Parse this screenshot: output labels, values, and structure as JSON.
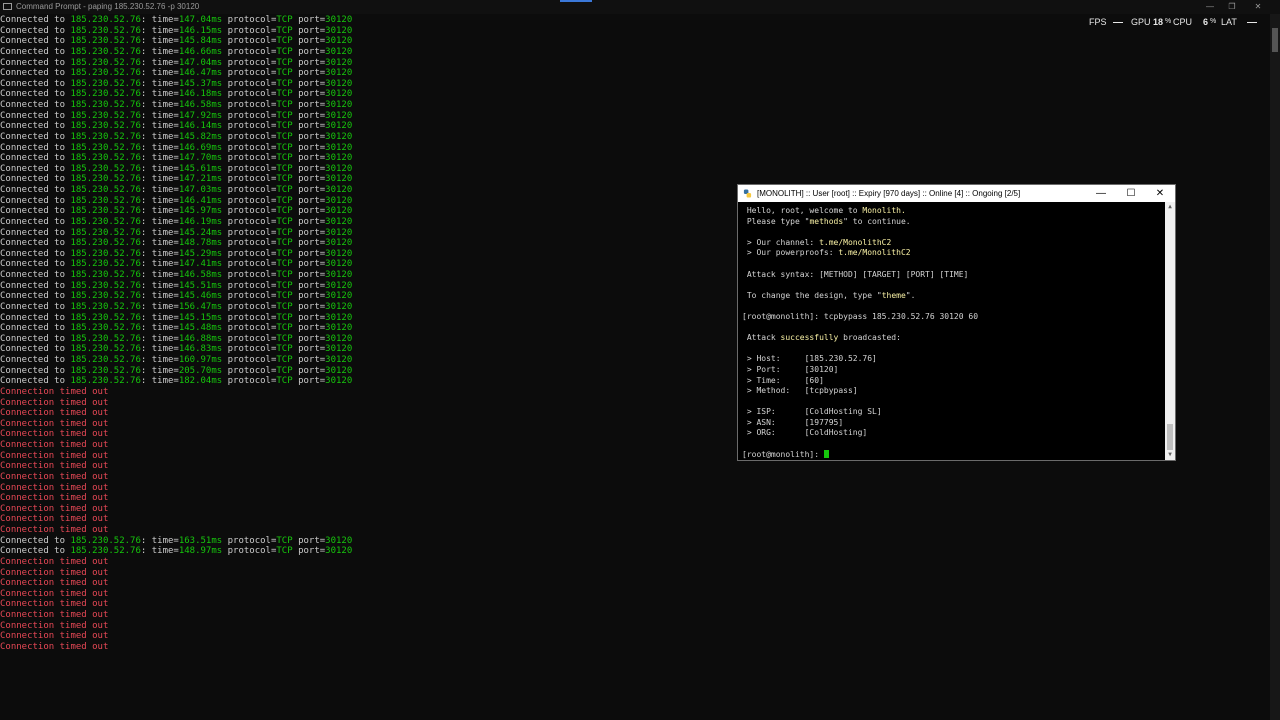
{
  "window": {
    "title": "Command Prompt - paping  185.230.52.76 -p 30120",
    "minimize": "—",
    "restore": "❐",
    "close": "✕"
  },
  "overlay": {
    "fps_label": "FPS",
    "gpu_label": "GPU",
    "gpu_value": "18",
    "gpu_unit": "%",
    "cpu_label": "CPU",
    "cpu_value": "6",
    "cpu_unit": "%",
    "lat_label": "LAT"
  },
  "console": {
    "connected_prefix": "Connected to ",
    "ip": "185.230.52.76",
    "time_label": ": time=",
    "protocol_label": " protocol=",
    "protocol": "TCP",
    "port_label": " port=",
    "port": "30120",
    "timeout_text": "Connection timed out",
    "lines": [
      {
        "t": "ok",
        "ms": "147.04ms"
      },
      {
        "t": "ok",
        "ms": "146.15ms"
      },
      {
        "t": "ok",
        "ms": "145.84ms"
      },
      {
        "t": "ok",
        "ms": "146.66ms"
      },
      {
        "t": "ok",
        "ms": "147.04ms"
      },
      {
        "t": "ok",
        "ms": "146.47ms"
      },
      {
        "t": "ok",
        "ms": "145.37ms"
      },
      {
        "t": "ok",
        "ms": "146.18ms"
      },
      {
        "t": "ok",
        "ms": "146.58ms"
      },
      {
        "t": "ok",
        "ms": "147.92ms"
      },
      {
        "t": "ok",
        "ms": "146.14ms"
      },
      {
        "t": "ok",
        "ms": "145.82ms"
      },
      {
        "t": "ok",
        "ms": "146.69ms"
      },
      {
        "t": "ok",
        "ms": "147.70ms"
      },
      {
        "t": "ok",
        "ms": "145.61ms"
      },
      {
        "t": "ok",
        "ms": "147.21ms"
      },
      {
        "t": "ok",
        "ms": "147.03ms"
      },
      {
        "t": "ok",
        "ms": "146.41ms"
      },
      {
        "t": "ok",
        "ms": "145.97ms"
      },
      {
        "t": "ok",
        "ms": "146.19ms"
      },
      {
        "t": "ok",
        "ms": "145.24ms"
      },
      {
        "t": "ok",
        "ms": "148.78ms"
      },
      {
        "t": "ok",
        "ms": "145.29ms"
      },
      {
        "t": "ok",
        "ms": "147.41ms"
      },
      {
        "t": "ok",
        "ms": "146.58ms"
      },
      {
        "t": "ok",
        "ms": "145.51ms"
      },
      {
        "t": "ok",
        "ms": "145.46ms"
      },
      {
        "t": "ok",
        "ms": "156.47ms"
      },
      {
        "t": "ok",
        "ms": "145.15ms"
      },
      {
        "t": "ok",
        "ms": "145.48ms"
      },
      {
        "t": "ok",
        "ms": "146.88ms"
      },
      {
        "t": "ok",
        "ms": "146.83ms"
      },
      {
        "t": "ok",
        "ms": "160.97ms"
      },
      {
        "t": "ok",
        "ms": "205.70ms"
      },
      {
        "t": "ok",
        "ms": "182.04ms"
      },
      {
        "t": "err"
      },
      {
        "t": "err"
      },
      {
        "t": "err"
      },
      {
        "t": "err"
      },
      {
        "t": "err"
      },
      {
        "t": "err"
      },
      {
        "t": "err"
      },
      {
        "t": "err"
      },
      {
        "t": "err"
      },
      {
        "t": "err"
      },
      {
        "t": "err"
      },
      {
        "t": "err"
      },
      {
        "t": "err"
      },
      {
        "t": "err"
      },
      {
        "t": "ok",
        "ms": "163.51ms"
      },
      {
        "t": "ok",
        "ms": "148.97ms"
      },
      {
        "t": "err"
      },
      {
        "t": "err"
      },
      {
        "t": "err"
      },
      {
        "t": "err"
      },
      {
        "t": "err"
      },
      {
        "t": "err"
      },
      {
        "t": "err"
      },
      {
        "t": "err"
      },
      {
        "t": "err"
      }
    ]
  },
  "terminal": {
    "title": "[MONOLITH] :: User [root] :: Expiry [970 days] :: Online [4] :: Ongoing [2/5]",
    "minimize": "—",
    "maximize": "☐",
    "close": "✕",
    "lines": [
      [
        {
          "s": " Hello, root, welcome to "
        },
        {
          "s": "Monolith.",
          "c": "ylw"
        }
      ],
      [
        {
          "s": " Please type \""
        },
        {
          "s": "methods",
          "c": "ylw"
        },
        {
          "s": "\" to continue."
        }
      ],
      [
        {
          "s": ""
        }
      ],
      [
        {
          "s": " > Our channel: "
        },
        {
          "s": "t.me/MonolithC2",
          "c": "ylw"
        }
      ],
      [
        {
          "s": " > Our powerproofs: "
        },
        {
          "s": "t.me/MonolithC2",
          "c": "ylw"
        }
      ],
      [
        {
          "s": ""
        }
      ],
      [
        {
          "s": " Attack syntax: [METHOD] [TARGET] [PORT] [TIME]"
        }
      ],
      [
        {
          "s": ""
        }
      ],
      [
        {
          "s": " To change the design, type \""
        },
        {
          "s": "theme",
          "c": "ylw"
        },
        {
          "s": "\"."
        }
      ],
      [
        {
          "s": ""
        }
      ],
      [
        {
          "s": "[root@monolith]: tcpbypass 185.230.52.76 30120 60"
        }
      ],
      [
        {
          "s": ""
        }
      ],
      [
        {
          "s": " Attack "
        },
        {
          "s": "successfully",
          "c": "ylw"
        },
        {
          "s": " broadcasted:"
        }
      ],
      [
        {
          "s": ""
        }
      ],
      [
        {
          "s": " > Host:     [185.230.52.76]"
        }
      ],
      [
        {
          "s": " > Port:     [30120]"
        }
      ],
      [
        {
          "s": " > Time:     [60]"
        }
      ],
      [
        {
          "s": " > Method:   [tcpbypass]"
        }
      ],
      [
        {
          "s": ""
        }
      ],
      [
        {
          "s": " > ISP:      [ColdHosting SL]"
        }
      ],
      [
        {
          "s": " > ASN:      [197795]"
        }
      ],
      [
        {
          "s": " > ORG:      [ColdHosting]"
        }
      ],
      [
        {
          "s": ""
        }
      ],
      [
        {
          "s": "[root@monolith]: "
        },
        {
          "cursor": true
        }
      ]
    ]
  }
}
